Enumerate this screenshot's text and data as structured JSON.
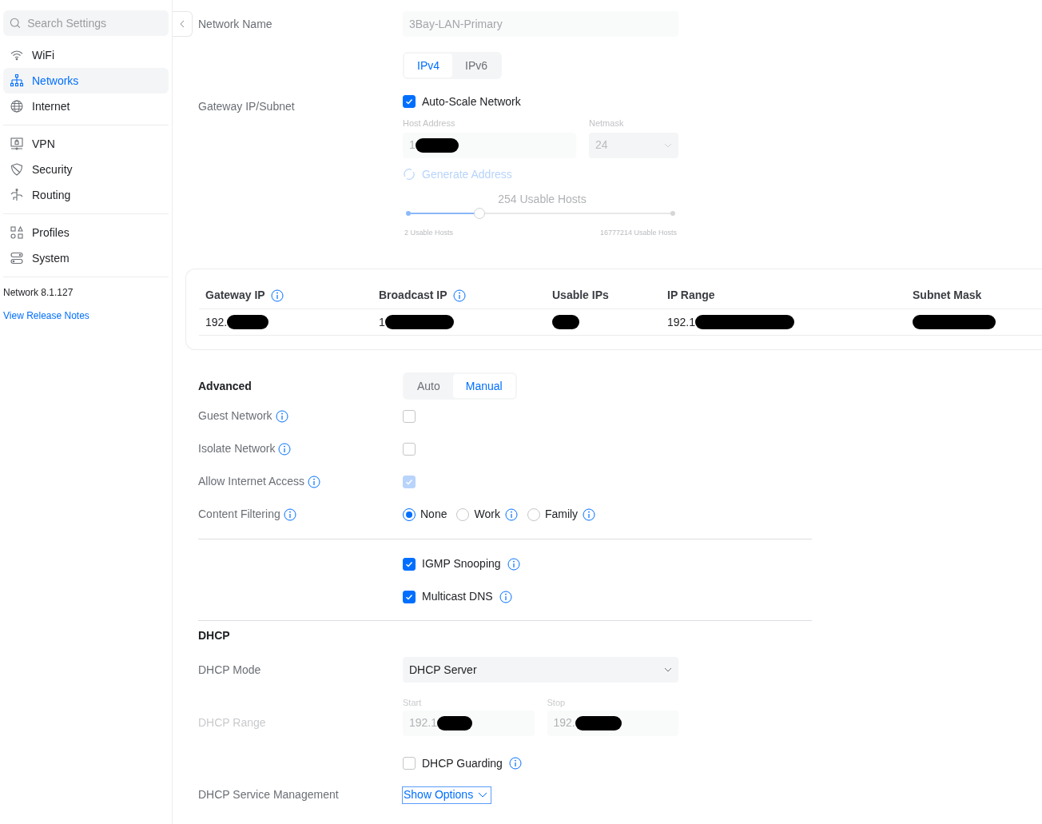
{
  "sidebar": {
    "search": {
      "placeholder": "Search Settings"
    },
    "groups": [
      [
        {
          "label": "WiFi",
          "selected": false
        },
        {
          "label": "Networks",
          "selected": true
        },
        {
          "label": "Internet",
          "selected": false
        }
      ],
      [
        {
          "label": "VPN",
          "selected": false
        },
        {
          "label": "Security",
          "selected": false
        },
        {
          "label": "Routing",
          "selected": false
        }
      ],
      [
        {
          "label": "Profiles",
          "selected": false
        },
        {
          "label": "System",
          "selected": false
        }
      ]
    ],
    "version": "Network 8.1.127",
    "release_link": "View Release Notes"
  },
  "network_name": {
    "label": "Network Name",
    "placeholder": "3Bay-LAN-Primary"
  },
  "ip_tabs": [
    {
      "label": "IPv4",
      "selected": true
    },
    {
      "label": "IPv6",
      "selected": false
    }
  ],
  "gateway": {
    "label": "Gateway IP/Subnet",
    "auto_scale": {
      "label": "Auto-Scale Network",
      "checked": true
    },
    "host_address": {
      "label": "Host Address",
      "value": "1",
      "redacted": true
    },
    "netmask": {
      "label": "Netmask",
      "value": "24",
      "disabled": true
    },
    "generate": {
      "label": "Generate Address",
      "disabled": true
    },
    "hosts_slider": {
      "reading": "254 Usable Hosts",
      "level": 0.27,
      "min_label": "2 Usable Hosts",
      "max_label": "16777214 Usable Hosts"
    }
  },
  "summary_table": {
    "columns": [
      {
        "label": "Gateway IP",
        "info": true
      },
      {
        "label": "Broadcast IP",
        "info": true
      },
      {
        "label": "Usable IPs"
      },
      {
        "label": "IP Range"
      },
      {
        "label": "Subnet Mask"
      }
    ],
    "row": [
      {
        "text": "192.",
        "redacted": true
      },
      {
        "text": "1",
        "redacted": true
      },
      {
        "redacted": true
      },
      {
        "text": "192.1",
        "redacted": true
      },
      {
        "redacted": true
      }
    ]
  },
  "advanced": {
    "label": "Advanced",
    "modes": [
      {
        "label": "Auto",
        "selected": false
      },
      {
        "label": "Manual",
        "selected": true
      }
    ],
    "options": [
      {
        "kind": "checkbox",
        "label": "Guest Network",
        "info": true,
        "checked": false
      },
      {
        "kind": "checkbox",
        "label": "Isolate Network",
        "info": true,
        "checked": false
      },
      {
        "kind": "checkbox",
        "label": "Allow Internet Access",
        "info": true,
        "checked": true,
        "disabled": true
      },
      {
        "kind": "radio",
        "label": "Content Filtering",
        "info": true,
        "choices": [
          {
            "label": "None",
            "selected": true
          },
          {
            "label": "Work",
            "info": true,
            "selected": false
          },
          {
            "label": "Family",
            "info": true,
            "selected": false
          }
        ]
      }
    ],
    "multicast": [
      {
        "label": "IGMP Snooping",
        "info": true,
        "checked": true
      },
      {
        "label": "Multicast DNS",
        "info": true,
        "checked": true
      }
    ]
  },
  "dhcp": {
    "title": "DHCP",
    "mode": {
      "label": "DHCP Mode",
      "value": "DHCP Server"
    },
    "range": {
      "label": "DHCP Range",
      "disabled": true,
      "start": {
        "label": "Start",
        "value": "192.1",
        "redacted": true
      },
      "stop": {
        "label": "Stop",
        "value": "192.",
        "redacted": true
      }
    },
    "guarding": {
      "label": "DHCP Guarding",
      "info": true,
      "checked": false
    },
    "service": {
      "label": "DHCP Service Management",
      "button": "Show Options"
    }
  }
}
